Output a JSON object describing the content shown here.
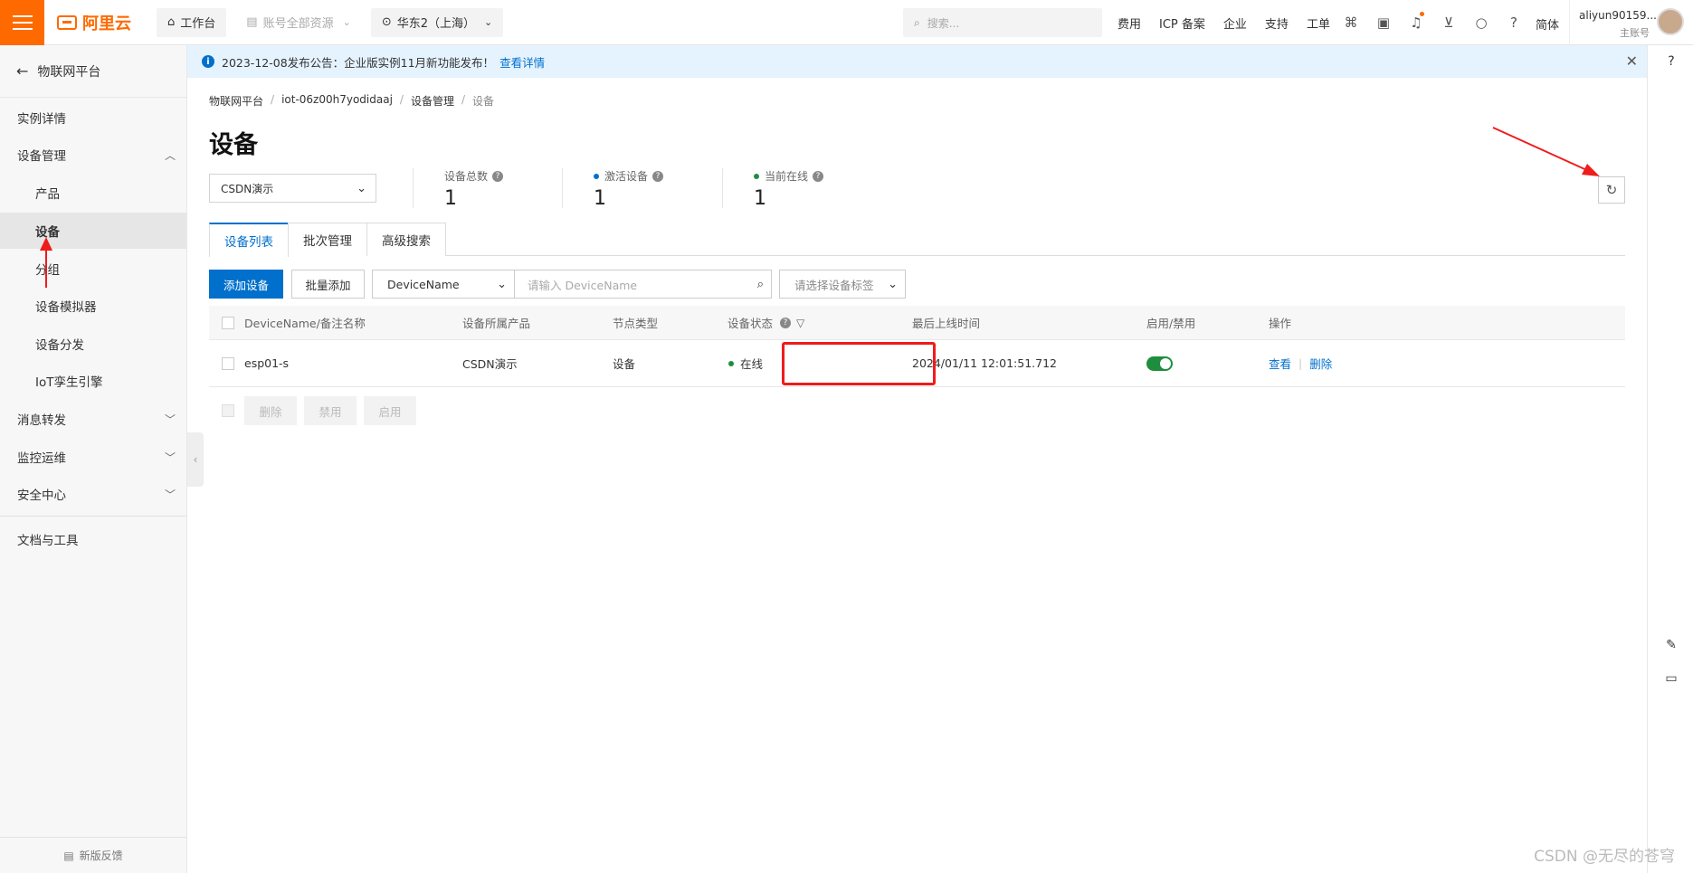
{
  "topbar": {
    "brand": "阿里云",
    "workbench": "工作台",
    "resource_scope": "账号全部资源",
    "region": "华东2（上海）",
    "search_placeholder": "搜索...",
    "links": [
      "费用",
      "ICP 备案",
      "企业",
      "支持",
      "工单"
    ],
    "language": "简体",
    "user_name": "aliyun90159...",
    "user_role": "主账号",
    "accent_color": "#ff6a00"
  },
  "sidebar": {
    "back_label": "物联网平台",
    "items": [
      {
        "label": "实例详情"
      },
      {
        "label": "设备管理"
      },
      {
        "label": "产品"
      },
      {
        "label": "设备"
      },
      {
        "label": "分组"
      },
      {
        "label": "设备模拟器"
      },
      {
        "label": "设备分发"
      },
      {
        "label": "IoT孪生引擎"
      },
      {
        "label": "消息转发"
      },
      {
        "label": "监控运维"
      },
      {
        "label": "安全中心"
      },
      {
        "label": "文档与工具"
      }
    ],
    "feedback_label": "新版反馈"
  },
  "notice": {
    "text": "2023-12-08发布公告：企业版实例11月新功能发布！",
    "link": "查看详情"
  },
  "breadcrumb": [
    "物联网平台",
    "iot-06z00h7yodidaaj",
    "设备管理",
    "设备"
  ],
  "page": {
    "title": "设备",
    "product_selected": "CSDN演示"
  },
  "stats": [
    {
      "label": "设备总数",
      "value": "1"
    },
    {
      "label": "激活设备",
      "value": "1",
      "dot_color": "#0070cc"
    },
    {
      "label": "当前在线",
      "value": "1",
      "dot_color": "#1e8e3e"
    }
  ],
  "tabs": [
    "设备列表",
    "批次管理",
    "高级搜索"
  ],
  "toolbar": {
    "add_device": "添加设备",
    "batch_add": "批量添加",
    "field_select": "DeviceName",
    "search_placeholder": "请输入 DeviceName",
    "tag_placeholder": "请选择设备标签"
  },
  "table": {
    "headers": [
      "DeviceName/备注名称",
      "设备所属产品",
      "节点类型",
      "设备状态",
      "最后上线时间",
      "启用/禁用",
      "操作"
    ],
    "rows": [
      {
        "name": "esp01-s",
        "product": "CSDN演示",
        "node_type": "设备",
        "status": "在线",
        "last_online": "2024/01/11 12:01:51.712",
        "enabled": true,
        "actions": [
          "查看",
          "删除"
        ]
      }
    ]
  },
  "bulk_actions": [
    "删除",
    "禁用",
    "启用"
  ],
  "watermark": "CSDN @无尽的苍穹"
}
